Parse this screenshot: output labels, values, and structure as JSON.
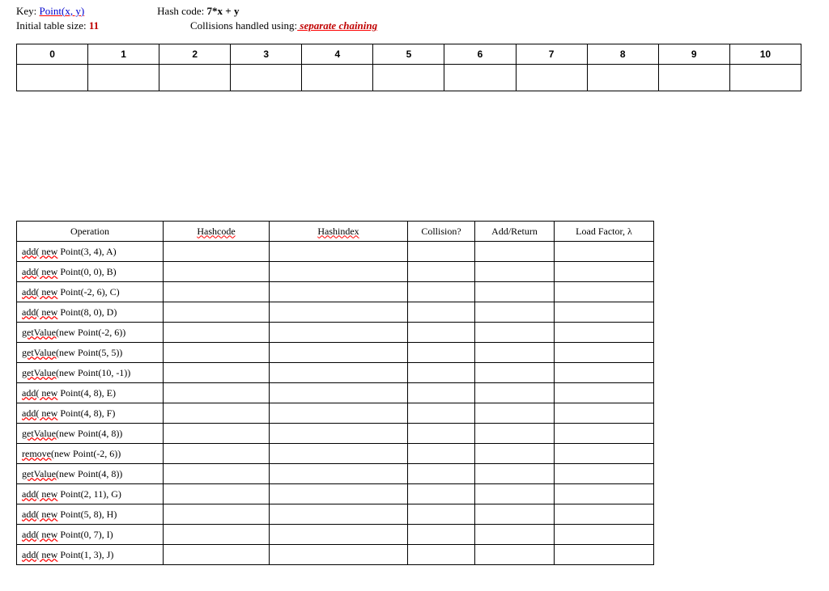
{
  "header": {
    "key_label": "Key: ",
    "key_value": "Point(x, y)",
    "hashcode_label": "Hash code: ",
    "hashcode_value": "7*x + y",
    "table_size_label": "Initial table size: ",
    "table_size_value": "11",
    "collision_label": "Collisions handled using:",
    "collision_value": " separate chaining"
  },
  "hash_table": {
    "indices": [
      "0",
      "1",
      "2",
      "3",
      "4",
      "5",
      "6",
      "7",
      "8",
      "9",
      "10"
    ]
  },
  "ops_table": {
    "headers": {
      "operation": "Operation",
      "hashcode": "Hashcode",
      "hashindex": "Hashindex",
      "collision": "Collision?",
      "add_return": "Add/Return",
      "load_factor": "Load Factor, λ"
    },
    "rows": [
      {
        "fn": "add( new",
        "args": " Point(3, 4), A)"
      },
      {
        "fn": "add( new",
        "args": " Point(0, 0), B)"
      },
      {
        "fn": "add( new",
        "args": " Point(-2, 6), C)"
      },
      {
        "fn": "add( new",
        "args": " Point(8, 0), D)"
      },
      {
        "fn": "getValue(",
        "args": "new Point(-2, 6))"
      },
      {
        "fn": "getValue(",
        "args": "new Point(5, 5))"
      },
      {
        "fn": "getValue(",
        "args": "new Point(10, -1))"
      },
      {
        "fn": "add( new",
        "args": " Point(4, 8), E)"
      },
      {
        "fn": "add( new",
        "args": " Point(4, 8), F)"
      },
      {
        "fn": "getValue(",
        "args": "new Point(4, 8))"
      },
      {
        "fn": "remove(",
        "args": "new Point(-2, 6))"
      },
      {
        "fn": "getValue(",
        "args": "new Point(4, 8))"
      },
      {
        "fn": "add( new",
        "args": " Point(2, 11), G)"
      },
      {
        "fn": "add( new",
        "args": " Point(5, 8), H)"
      },
      {
        "fn": "add( new",
        "args": " Point(0, 7), I)"
      },
      {
        "fn": "add( new",
        "args": " Point(1, 3), J)"
      }
    ]
  }
}
